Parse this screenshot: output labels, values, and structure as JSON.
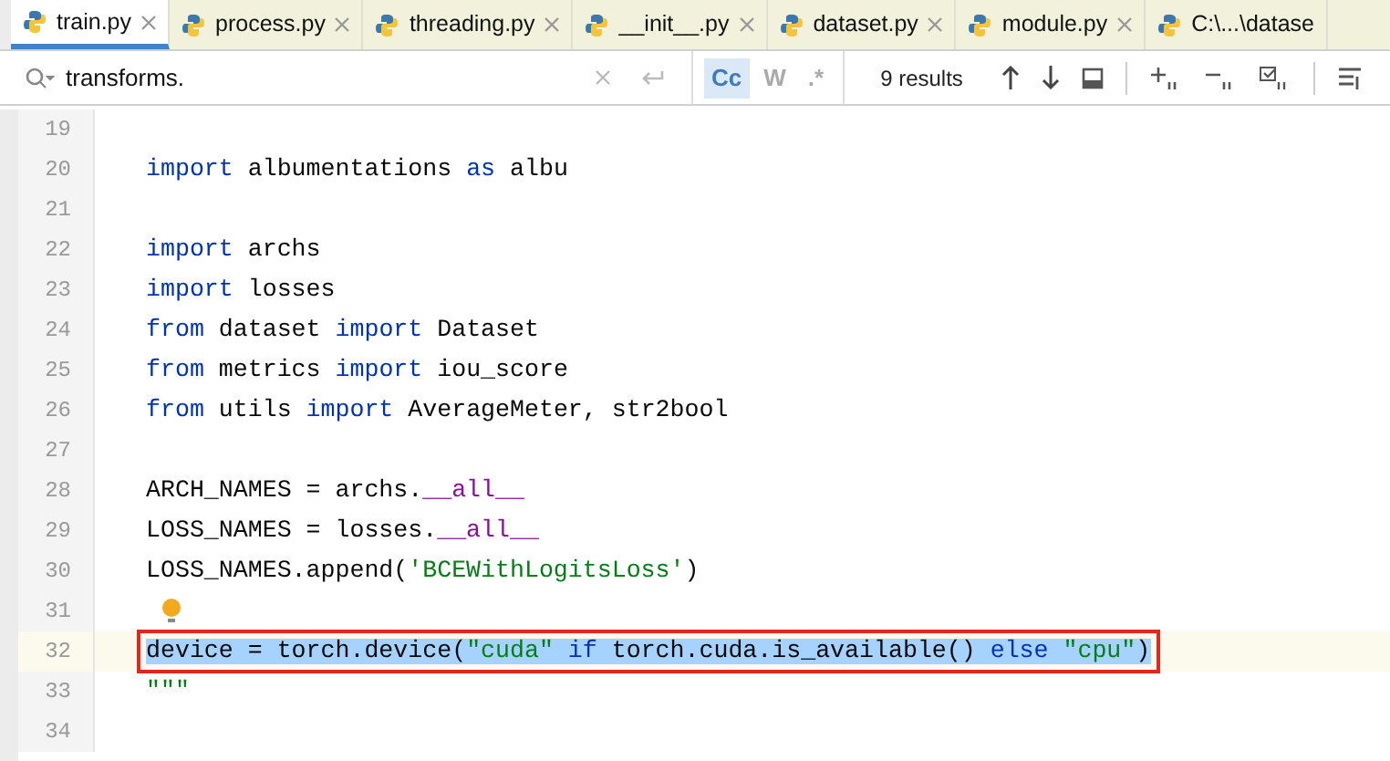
{
  "tabs": [
    {
      "label": "train.py",
      "selected": true,
      "closable": true
    },
    {
      "label": "process.py",
      "selected": false,
      "closable": true
    },
    {
      "label": "threading.py",
      "selected": false,
      "closable": true
    },
    {
      "label": "__init__.py",
      "selected": false,
      "closable": true
    },
    {
      "label": "dataset.py",
      "selected": false,
      "closable": true
    },
    {
      "label": "module.py",
      "selected": false,
      "closable": true
    },
    {
      "label": "C:\\...\\datase",
      "selected": false,
      "closable": false
    }
  ],
  "find_bar": {
    "value": "transforms.",
    "options": [
      {
        "label": "Cc",
        "selected": true
      },
      {
        "label": "W",
        "selected": false
      },
      {
        "label": ".*",
        "selected": false
      }
    ],
    "results": "9 results"
  },
  "editor": {
    "lines": [
      {
        "number": "19",
        "selected": false
      },
      {
        "number": "20",
        "selected": false,
        "tokens": [
          {
            "kind": "keyword",
            "text": "import"
          },
          {
            "kind": "plain",
            "text": " albumentations "
          },
          {
            "kind": "keyword",
            "text": "as"
          },
          {
            "kind": "plain",
            "text": " albu"
          }
        ]
      },
      {
        "number": "21",
        "selected": false
      },
      {
        "number": "22",
        "selected": false,
        "tokens": [
          {
            "kind": "keyword",
            "text": "import"
          },
          {
            "kind": "plain",
            "text": " archs"
          }
        ]
      },
      {
        "number": "23",
        "selected": false,
        "tokens": [
          {
            "kind": "keyword",
            "text": "import"
          },
          {
            "kind": "plain",
            "text": " losses"
          }
        ]
      },
      {
        "number": "24",
        "selected": false,
        "tokens": [
          {
            "kind": "keyword",
            "text": "from"
          },
          {
            "kind": "plain",
            "text": " dataset "
          },
          {
            "kind": "keyword",
            "text": "import"
          },
          {
            "kind": "plain",
            "text": " Dataset"
          }
        ]
      },
      {
        "number": "25",
        "selected": false,
        "tokens": [
          {
            "kind": "keyword",
            "text": "from"
          },
          {
            "kind": "plain",
            "text": " metrics "
          },
          {
            "kind": "keyword",
            "text": "import"
          },
          {
            "kind": "plain",
            "text": " iou_score"
          }
        ]
      },
      {
        "number": "26",
        "selected": false,
        "tokens": [
          {
            "kind": "keyword",
            "text": "from"
          },
          {
            "kind": "plain",
            "text": " utils "
          },
          {
            "kind": "keyword",
            "text": "import"
          },
          {
            "kind": "plain",
            "text": " AverageMeter, str2bool"
          }
        ]
      },
      {
        "number": "27",
        "selected": false
      },
      {
        "number": "28",
        "selected": false,
        "tokens": [
          {
            "kind": "plain",
            "text": "ARCH_NAMES = archs."
          },
          {
            "kind": "dunder",
            "text": "__all__"
          }
        ]
      },
      {
        "number": "29",
        "selected": false,
        "tokens": [
          {
            "kind": "plain",
            "text": "LOSS_NAMES = losses."
          },
          {
            "kind": "dunder",
            "text": "__all__"
          }
        ]
      },
      {
        "number": "30",
        "selected": false,
        "tokens": [
          {
            "kind": "plain",
            "text": "LOSS_NAMES.append("
          },
          {
            "kind": "string",
            "text": "'BCEWithLogitsLoss'"
          },
          {
            "kind": "plain",
            "text": ")"
          }
        ]
      },
      {
        "number": "31",
        "selected": false,
        "hint": true
      },
      {
        "number": "32",
        "selected": true,
        "tokens": [
          {
            "kind": "plain",
            "text": "device = torch.device("
          },
          {
            "kind": "string",
            "text": "\"cuda\" "
          },
          {
            "kind": "keyword",
            "text": "if"
          },
          {
            "kind": "plain",
            "text": " torch.cuda.is_available() "
          },
          {
            "kind": "keyword",
            "text": "else"
          },
          {
            "kind": "string",
            "text": " \"cpu\""
          },
          {
            "kind": "plain",
            "text": ")"
          }
        ]
      },
      {
        "number": "33",
        "selected": false,
        "tokens": [
          {
            "kind": "string",
            "text": "\"\"\""
          }
        ]
      },
      {
        "number": "34",
        "selected": false
      }
    ]
  }
}
